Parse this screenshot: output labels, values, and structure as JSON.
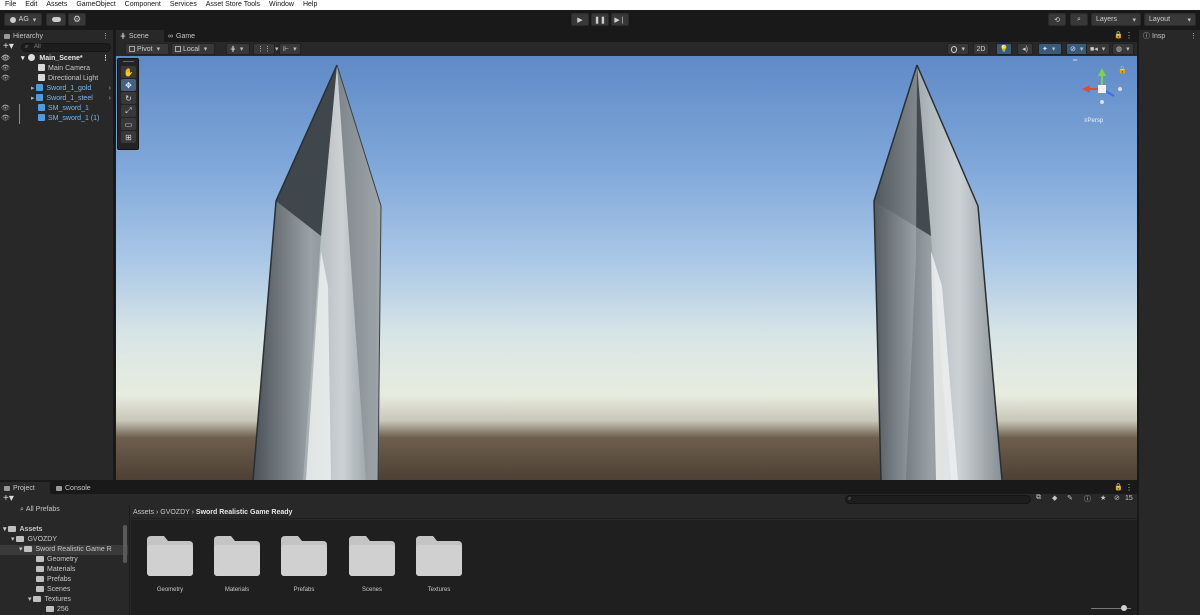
{
  "menu": [
    "File",
    "Edit",
    "Assets",
    "GameObject",
    "Component",
    "Services",
    "Asset Store Tools",
    "Window",
    "Help"
  ],
  "toolbar": {
    "account_label": "AG",
    "layers_label": "Layers",
    "layout_label": "Layout"
  },
  "hierarchy": {
    "tab_label": "Hierarchy",
    "search_placeholder": "All",
    "scene_name": "Main_Scene*",
    "items": [
      {
        "label": "Main Camera"
      },
      {
        "label": "Directional Light"
      },
      {
        "label": "Sword_1_gold"
      },
      {
        "label": "Sword_1_steel"
      },
      {
        "label": "SM_sword_1"
      },
      {
        "label": "SM_sword_1 (1)"
      }
    ]
  },
  "scene": {
    "tabs": [
      "Scene",
      "Game"
    ],
    "pivot_label": "Pivot",
    "local_label": "Local",
    "mode_2d_label": "2D",
    "persp_label": "≡Persp"
  },
  "inspector": {
    "tab_label": "Insp"
  },
  "project": {
    "tabs": [
      "Project",
      "Console"
    ],
    "search_placeholder": "",
    "count_label": "15",
    "favorites_label": "All Prefabs",
    "tree": [
      {
        "label": "Assets"
      },
      {
        "label": "GVOZDY"
      },
      {
        "label": "Sword Realistic Game R"
      },
      {
        "label": "Geometry"
      },
      {
        "label": "Materials"
      },
      {
        "label": "Prefabs"
      },
      {
        "label": "Scenes"
      },
      {
        "label": "Textures"
      },
      {
        "label": "256"
      }
    ],
    "breadcrumb": [
      "Assets",
      "GVOZDY",
      "Sword Realistic Game Ready"
    ],
    "folders": [
      {
        "label": "Geometry"
      },
      {
        "label": "Materials"
      },
      {
        "label": "Prefabs"
      },
      {
        "label": "Scenes"
      },
      {
        "label": "Textures"
      }
    ]
  }
}
